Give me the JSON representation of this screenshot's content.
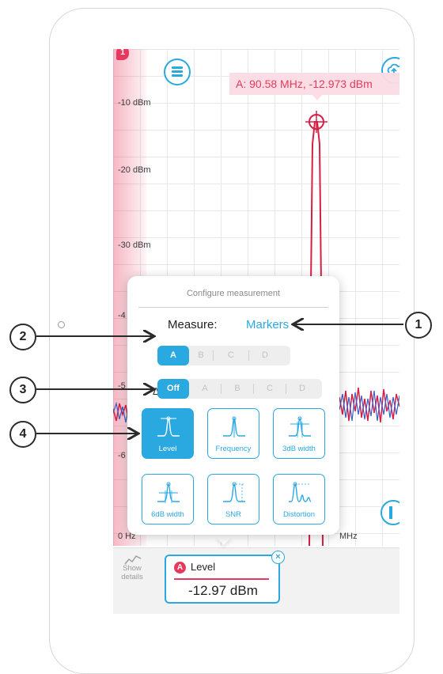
{
  "status": {
    "warning_count": "1"
  },
  "chart": {
    "y_labels": [
      "-10 dBm",
      "-20 dBm",
      "-30 dBm",
      "-4",
      "-5",
      "-6",
      "0 Hz"
    ],
    "x_label_right": "MHz",
    "marker_readout": "A: 90.58 MHz, -12.973 dBm"
  },
  "popover": {
    "title": "Configure measurement",
    "measure_label": "Measure:",
    "measure_value": "Markers",
    "marker_options": [
      "A",
      "B",
      "C",
      "D"
    ],
    "marker_selected": "A",
    "delta_symbol": "Δ",
    "delta_options": [
      "Off",
      "A",
      "B",
      "C",
      "D"
    ],
    "delta_selected": "Off",
    "tiles": [
      {
        "label": "Level",
        "icon": "level-peak-icon",
        "active": true
      },
      {
        "label": "Frequency",
        "icon": "frequency-peak-icon",
        "active": false
      },
      {
        "label": "3dB width",
        "icon": "3db-width-icon",
        "active": false
      },
      {
        "label": "6dB width",
        "icon": "6db-width-icon",
        "active": false
      },
      {
        "label": "SNR",
        "icon": "snr-icon",
        "active": false
      },
      {
        "label": "Distortion",
        "icon": "distortion-icon",
        "active": false
      }
    ]
  },
  "bottom": {
    "show_details": "Show details",
    "card": {
      "marker": "A",
      "type": "Level",
      "value": "-12.97 dBm"
    }
  },
  "callouts": [
    "1",
    "2",
    "3",
    "4"
  ],
  "colors": {
    "accent": "#2aa8e0",
    "marker_red": "#e8385e",
    "trace_blue": "#3a5fc8"
  }
}
